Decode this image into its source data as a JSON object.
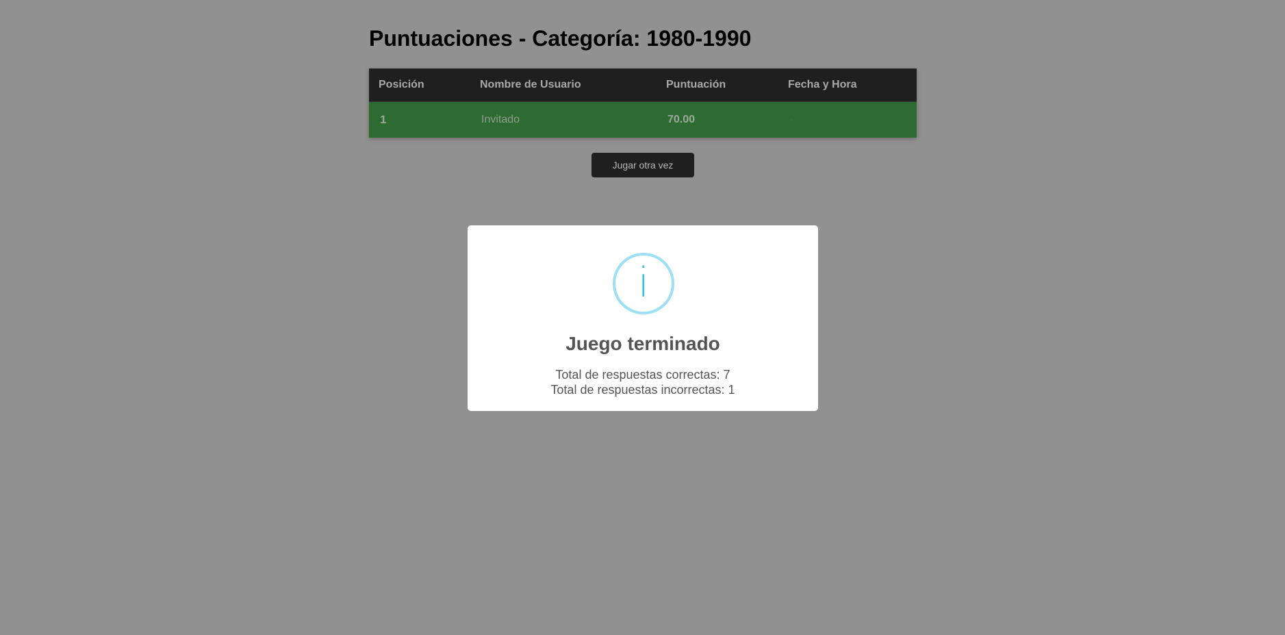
{
  "page": {
    "title": "Puntuaciones - Categoría: 1980-1990"
  },
  "table": {
    "headers": {
      "position": "Posición",
      "username": "Nombre de Usuario",
      "score": "Puntuación",
      "datetime": "Fecha y Hora"
    },
    "rows": [
      {
        "position": "1",
        "username": "Invitado",
        "score": "70.00",
        "datetime": "-"
      }
    ]
  },
  "actions": {
    "play_again_label": "Jugar otra vez"
  },
  "modal": {
    "icon": "info-icon",
    "icon_glyph": "i",
    "title": "Juego terminado",
    "correct_text": "Total de respuestas correctas: 7",
    "incorrect_text": "Total de respuestas incorrectas: 1"
  },
  "colors": {
    "background_overlay": "#919191",
    "table_header": "#1f1f1f",
    "row_highlight": "#2e6b32",
    "info_accent": "#3fc3ee"
  }
}
